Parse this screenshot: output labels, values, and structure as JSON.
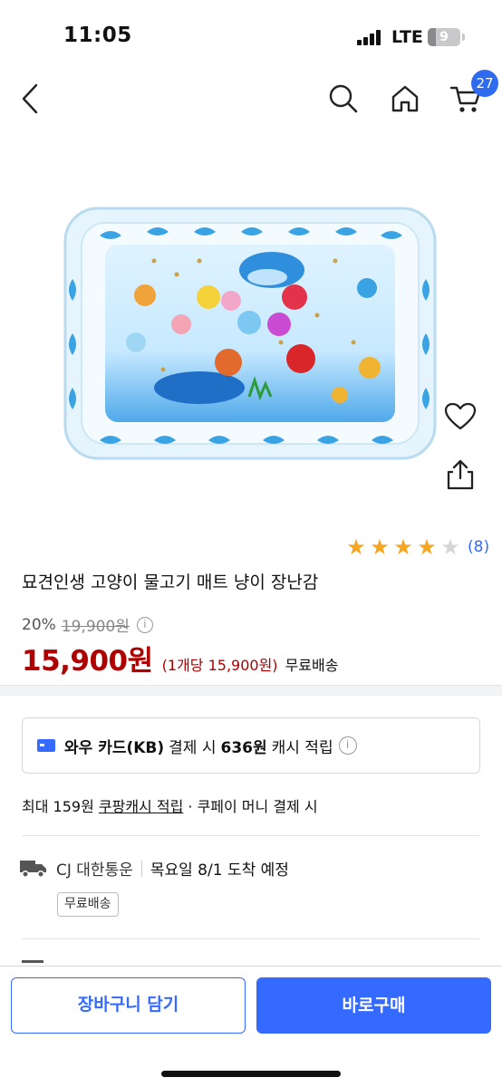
{
  "status_bar": {
    "time": "11:05",
    "network": "LTE",
    "battery": "9",
    "battery_level": 0.09
  },
  "nav": {
    "back_icon": "chevron-left-icon",
    "search_icon": "search-icon",
    "home_icon": "home-icon",
    "cart_icon": "cart-icon",
    "cart_count": "27"
  },
  "product": {
    "image_icon": "inflatable-water-play-mat-image",
    "title": "묘견인생 고양이 물고기 매트 냥이 장난감",
    "rating_value": 4,
    "rating_max": 5,
    "review_count": "(8)",
    "discount": "20%",
    "original_price": "19,900원",
    "sale_price": "15,900원",
    "unit_price": "(1개당 15,900원)",
    "free_shipping": "무료배송"
  },
  "actions": {
    "wishlist_icon": "heart-icon",
    "share_icon": "share-icon"
  },
  "card_benefit": {
    "card_name": "와우 카드(KB)",
    "text_mid": "결제 시",
    "amount": "636원",
    "text_end": "캐시 적립"
  },
  "cash": {
    "prefix": "최대 159원",
    "link": "쿠팡캐시 적립",
    "suffix": "· 쿠페이 머니 결제 시"
  },
  "delivery": {
    "truck_icon": "truck-icon",
    "carrier": "CJ 대한통운",
    "arrival": "목요일 8/1 도착 예정",
    "badge": "무료배송"
  },
  "colors": {
    "accent": "#346aff",
    "price_red": "#ae0000",
    "star": "#f5a623",
    "badge": "#2e6bef"
  },
  "bottom": {
    "cart_button": "장바구니 담기",
    "buy_button": "바로구매"
  }
}
